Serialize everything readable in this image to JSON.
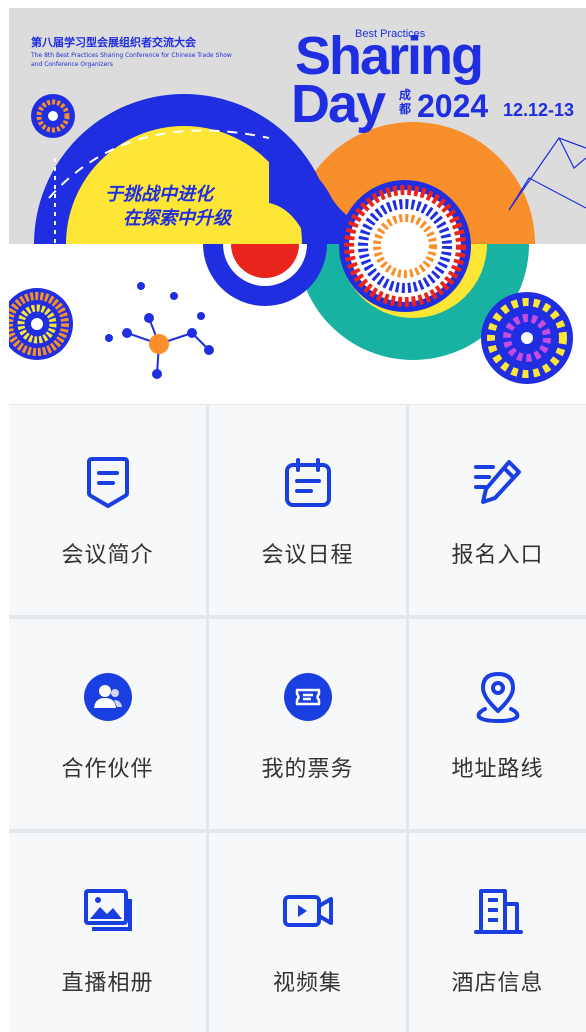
{
  "banner": {
    "edition_cn": "第八届学习型会展组织者交流大会",
    "edition_en_line1": "The 8th Best Practices Sharing Conference for Chinese Trade Show",
    "edition_en_line2": "and Conference Organizers",
    "brand_small": "Best Practices",
    "brand_line1": "Sharing",
    "brand_line2": "Day",
    "city": "成都",
    "year": "2024",
    "dates": "12.12-13",
    "slogan_line1": "于挑战中进化",
    "slogan_line2": "在探索中升级"
  },
  "menu": [
    {
      "label": "会议简介",
      "icon": "document-icon"
    },
    {
      "label": "会议日程",
      "icon": "calendar-icon"
    },
    {
      "label": "报名入口",
      "icon": "signup-pen-icon"
    },
    {
      "label": "合作伙伴",
      "icon": "partner-icon"
    },
    {
      "label": "我的票务",
      "icon": "ticket-icon"
    },
    {
      "label": "地址路线",
      "icon": "location-icon"
    },
    {
      "label": "直播相册",
      "icon": "photo-album-icon"
    },
    {
      "label": "视频集",
      "icon": "video-icon"
    },
    {
      "label": "酒店信息",
      "icon": "hotel-icon"
    }
  ],
  "colors": {
    "accent": "#1a3fe0",
    "banner_blue": "#1f2ee0",
    "banner_orange": "#f98f2a",
    "banner_yellow": "#fde635",
    "banner_teal": "#18b2a2",
    "banner_red": "#e8241c"
  }
}
